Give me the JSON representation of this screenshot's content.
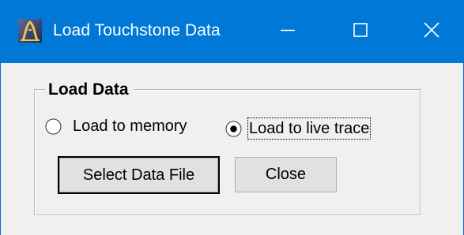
{
  "window": {
    "title": "Load Touchstone Data",
    "icon": "app-icon",
    "controls": {
      "minimize_icon": "minimize-icon",
      "maximize_icon": "maximize-icon",
      "close_icon": "close-icon"
    },
    "colors": {
      "titlebar": "#0078d7",
      "title_text": "#ffffff",
      "client_bg": "#f0f0f0",
      "button_bg": "#e1e1e1"
    }
  },
  "load_data_group": {
    "legend": "Load Data",
    "options": [
      {
        "label": "Load to memory",
        "selected": false
      },
      {
        "label": "Load to live trace",
        "selected": true
      }
    ]
  },
  "buttons": {
    "select_data_file": "Select Data File",
    "close": "Close"
  }
}
